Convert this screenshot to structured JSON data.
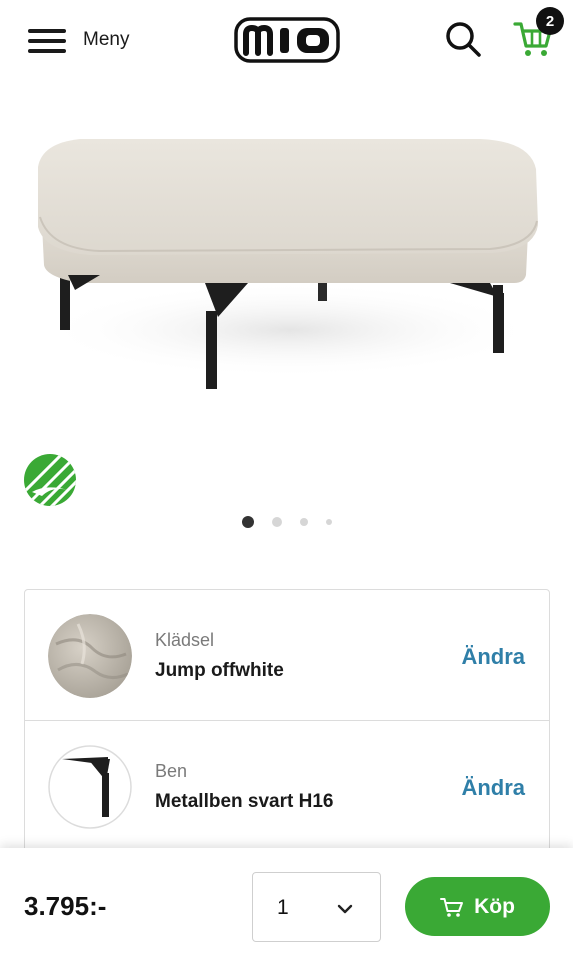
{
  "header": {
    "menu_label": "Meny",
    "logo_text": "mio",
    "cart_count": "2",
    "menu_icon": "hamburger-icon",
    "search_icon": "search-icon",
    "cart_icon": "cart-icon"
  },
  "gallery": {
    "slide_count": 4,
    "active_slide": 1
  },
  "options": [
    {
      "category": "Klädsel",
      "value": "Jump offwhite",
      "action": "Ändra"
    },
    {
      "category": "Ben",
      "value": "Metallben svart H16",
      "action": "Ändra"
    }
  ],
  "purchase": {
    "price": "3.795:-",
    "quantity": "1",
    "buy_label": "Köp"
  },
  "colors": {
    "accent_green": "#3aa935",
    "link_blue": "#2f7fa8",
    "eco_green": "#3aa935"
  }
}
